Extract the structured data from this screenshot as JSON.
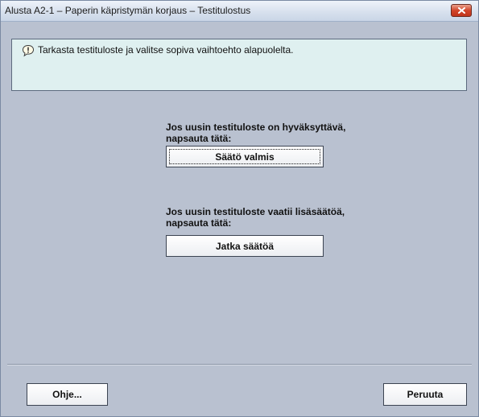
{
  "window": {
    "title": "Alusta A2-1 – Paperin käpristymän korjaus – Testitulostus"
  },
  "message": {
    "icon": "info-speech-icon",
    "text": "Tarkasta testituloste ja valitse sopiva vaihtoehto alapuolelta."
  },
  "options": [
    {
      "line1": "Jos uusin testituloste on hyväksyttävä,",
      "line2": "napsauta tätä:",
      "button_label": "Säätö valmis"
    },
    {
      "line1": "Jos uusin testituloste vaatii lisäsäätöä,",
      "line2": "napsauta tätä:",
      "button_label": "Jatka säätöä"
    }
  ],
  "footer": {
    "help_label": "Ohje...",
    "cancel_label": "Peruuta"
  },
  "colors": {
    "background": "#b9c1d0",
    "message_panel": "#dff0f0",
    "close_button": "#d2462a"
  }
}
